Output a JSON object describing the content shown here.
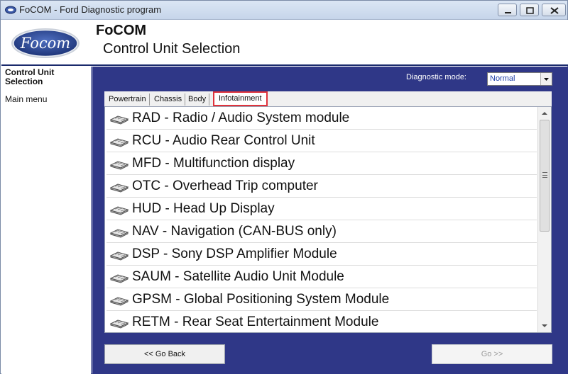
{
  "window": {
    "title": "FoCOM - Ford Diagnostic program"
  },
  "header": {
    "logo_text": "Focom",
    "app_name": "FoCOM",
    "page_title": "Control Unit Selection"
  },
  "sidebar": {
    "current": "Control Unit Selection",
    "main_menu": "Main menu"
  },
  "diagnostic": {
    "label": "Diagnostic mode:",
    "value": "Normal"
  },
  "tabs": [
    {
      "label": "Powertrain",
      "active": false
    },
    {
      "label": "Chassis",
      "active": false
    },
    {
      "label": "Body",
      "active": false
    },
    {
      "label": "Infotainment",
      "active": true
    }
  ],
  "modules": [
    {
      "label": "RAD - Radio / Audio System module"
    },
    {
      "label": "RCU - Audio Rear Control Unit"
    },
    {
      "label": "MFD - Multifunction display"
    },
    {
      "label": "OTC - Overhead Trip computer"
    },
    {
      "label": "HUD - Head Up Display"
    },
    {
      "label": "NAV - Navigation (CAN-BUS only)"
    },
    {
      "label": "DSP - Sony DSP Amplifier Module"
    },
    {
      "label": "SAUM - Satellite Audio Unit Module"
    },
    {
      "label": "GPSM - Global Positioning System Module"
    },
    {
      "label": "RETM - Rear Seat Entertainment Module"
    }
  ],
  "buttons": {
    "back": "<< Go Back",
    "go": "Go >>"
  },
  "colors": {
    "panel": "#2f3787",
    "active_tab_border": "#e0333c",
    "select_text": "#1f3fa8"
  }
}
